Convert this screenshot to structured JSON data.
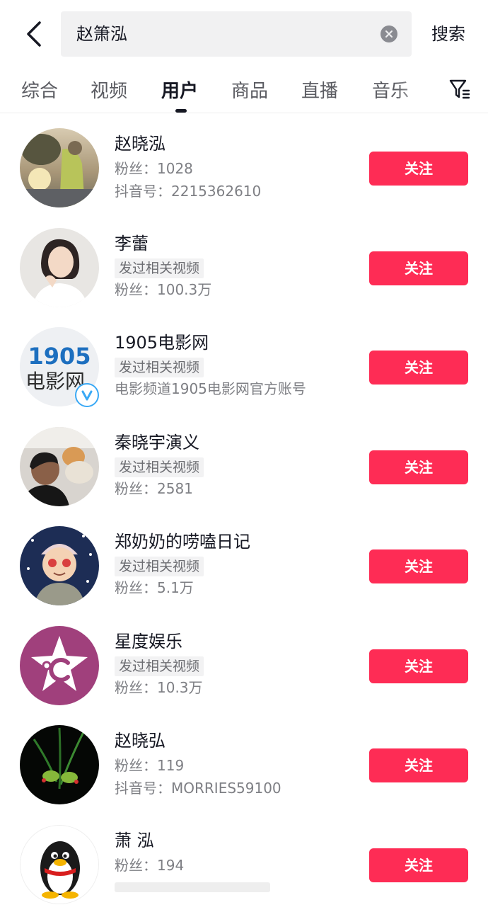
{
  "search": {
    "query": "赵箫泓",
    "button_label": "搜索"
  },
  "tabs": [
    {
      "label": "综合"
    },
    {
      "label": "视频"
    },
    {
      "label": "用户"
    },
    {
      "label": "商品"
    },
    {
      "label": "直播"
    },
    {
      "label": "音乐"
    }
  ],
  "active_tab": "用户",
  "colors": {
    "follow_button": "#fe2c55",
    "text_primary": "#161823",
    "text_secondary": "#7e7f84",
    "verified": "#3aa9f5"
  },
  "users": [
    {
      "name": "赵晓泓",
      "fans": "粉丝：1028",
      "extra": "抖音号：2215362610",
      "tag": "",
      "follow": "关注",
      "avatar": "outdoor-photo-avatar"
    },
    {
      "name": "李蕾",
      "tag": "发过相关视频",
      "fans": "粉丝：100.3万",
      "extra": "",
      "follow": "关注",
      "avatar": "woman-portrait-avatar"
    },
    {
      "name": "1905电影网",
      "tag": "发过相关视频",
      "fans": "",
      "extra": "电影频道1905电影网官方账号",
      "follow": "关注",
      "avatar": "1905-logo-avatar",
      "logo_top": "1905",
      "logo_bottom": "电影网",
      "verified": true
    },
    {
      "name": "秦晓宇演义",
      "tag": "发过相关视频",
      "fans": "粉丝：2581",
      "extra": "",
      "follow": "关注",
      "avatar": "man-with-cat-avatar"
    },
    {
      "name": "郑奶奶的唠嗑日记",
      "tag": "发过相关视频",
      "fans": "粉丝：5.1万",
      "extra": "",
      "follow": "关注",
      "avatar": "grandma-cartoon-avatar"
    },
    {
      "name": "星度娱乐",
      "tag": "发过相关视频",
      "fans": "粉丝：10.3万",
      "extra": "",
      "follow": "关注",
      "avatar": "star-logo-avatar"
    },
    {
      "name": "赵晓弘",
      "fans": "粉丝：119",
      "extra": "抖音号：MORRIES59100",
      "tag": "",
      "follow": "关注",
      "avatar": "plant-photo-avatar"
    },
    {
      "name": "萧 泓",
      "fans": "粉丝：194",
      "extra": "",
      "tag": "",
      "follow": "关注",
      "avatar": "qq-penguin-avatar"
    }
  ]
}
